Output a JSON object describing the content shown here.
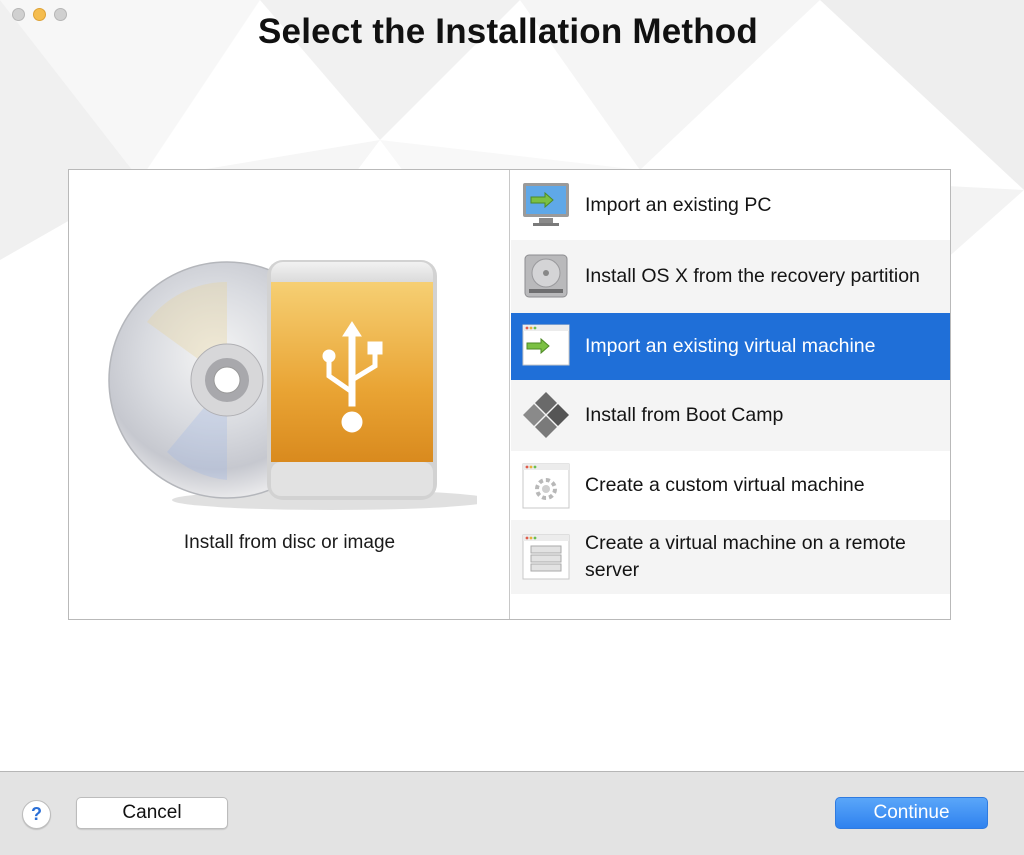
{
  "window": {
    "title": "Select the Installation Method"
  },
  "left_option": {
    "label": "Install from disc or image",
    "icon": "disc-and-usb-drive-icon"
  },
  "options": [
    {
      "label": "Import an existing PC",
      "icon": "pc-import-icon",
      "selected": false
    },
    {
      "label": "Install OS X from the recovery partition",
      "icon": "hard-drive-icon",
      "selected": false
    },
    {
      "label": "Import an existing virtual machine",
      "icon": "vm-import-icon",
      "selected": true
    },
    {
      "label": "Install from Boot Camp",
      "icon": "boot-camp-icon",
      "selected": false
    },
    {
      "label": "Create a custom virtual machine",
      "icon": "custom-vm-icon",
      "selected": false
    },
    {
      "label": "Create a virtual machine on a remote server",
      "icon": "remote-server-icon",
      "selected": false
    }
  ],
  "footer": {
    "help_label": "?",
    "cancel_label": "Cancel",
    "continue_label": "Continue"
  },
  "colors": {
    "selection": "#1f6fd8",
    "continue_button": "#3a8cf3",
    "usb_drive_orange": "#e8a02c"
  }
}
